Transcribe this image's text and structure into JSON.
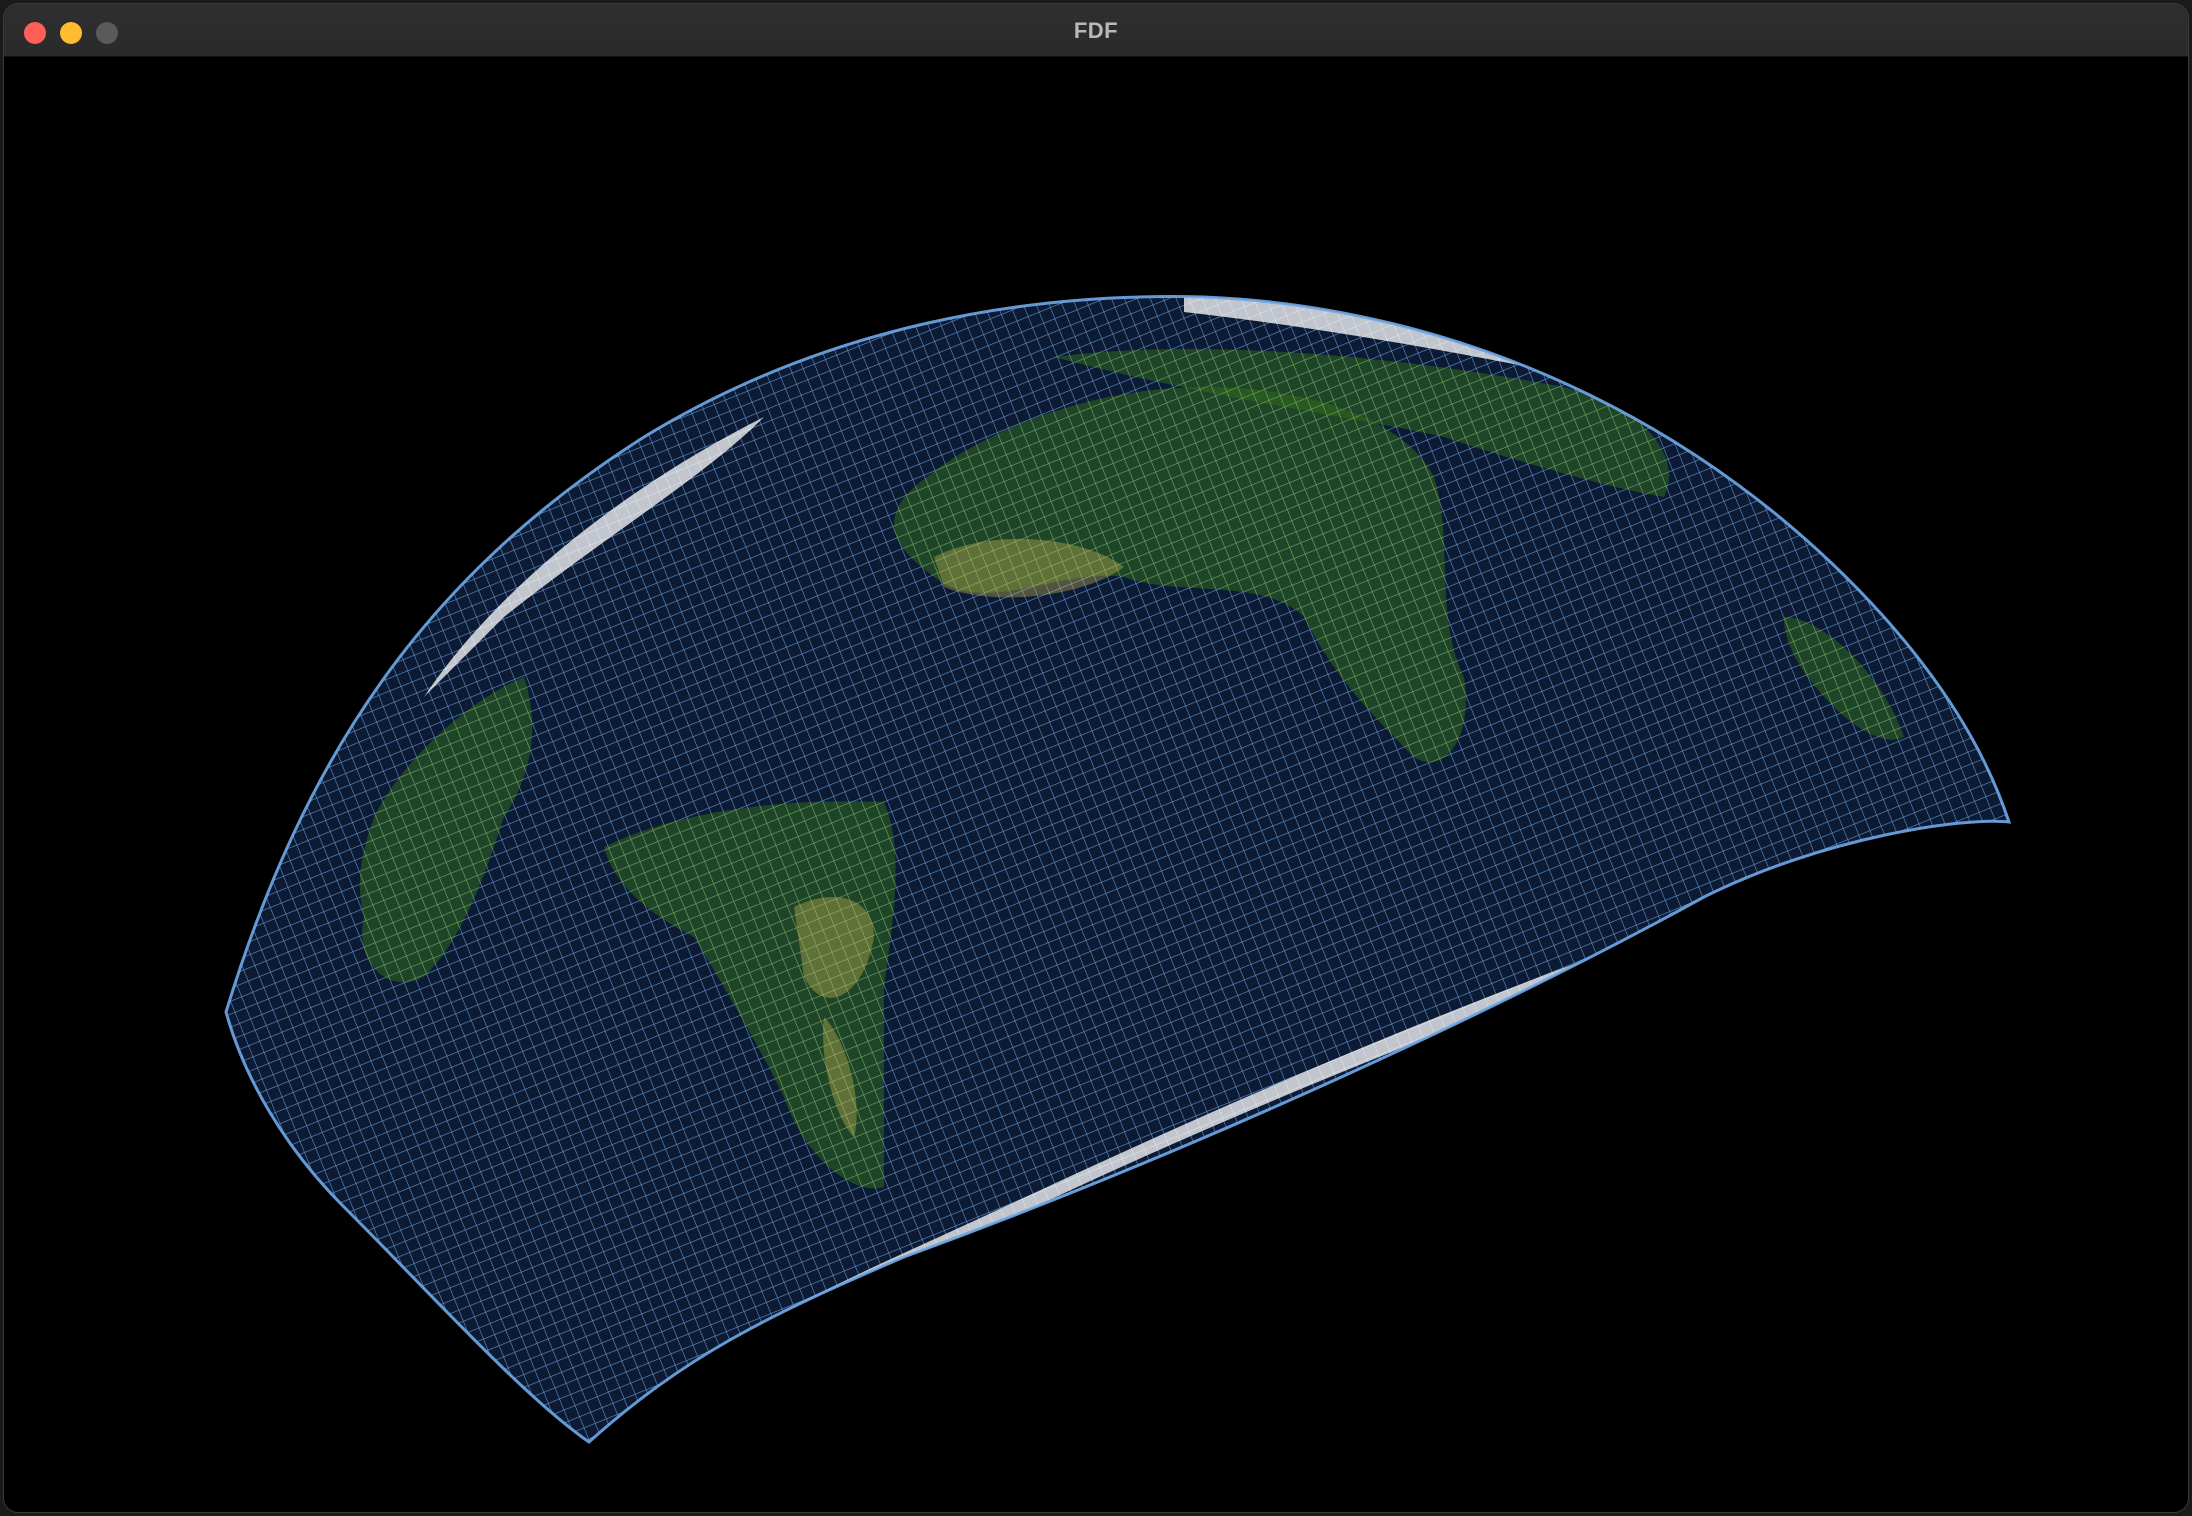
{
  "window": {
    "title": "FDF",
    "controls": [
      {
        "name": "close-button",
        "color": "#fe5f57"
      },
      {
        "name": "minimize-button",
        "color": "#febc2e"
      },
      {
        "name": "zoom-button",
        "color": "#5a5a5a"
      }
    ]
  },
  "scene": {
    "description_type": "wireframe-globe",
    "background": "#000000",
    "colors": {
      "ocean": "#6fa8e8",
      "land": "#2f6a1f",
      "desert": "#d8c25a",
      "ice": "#ffffff"
    }
  }
}
